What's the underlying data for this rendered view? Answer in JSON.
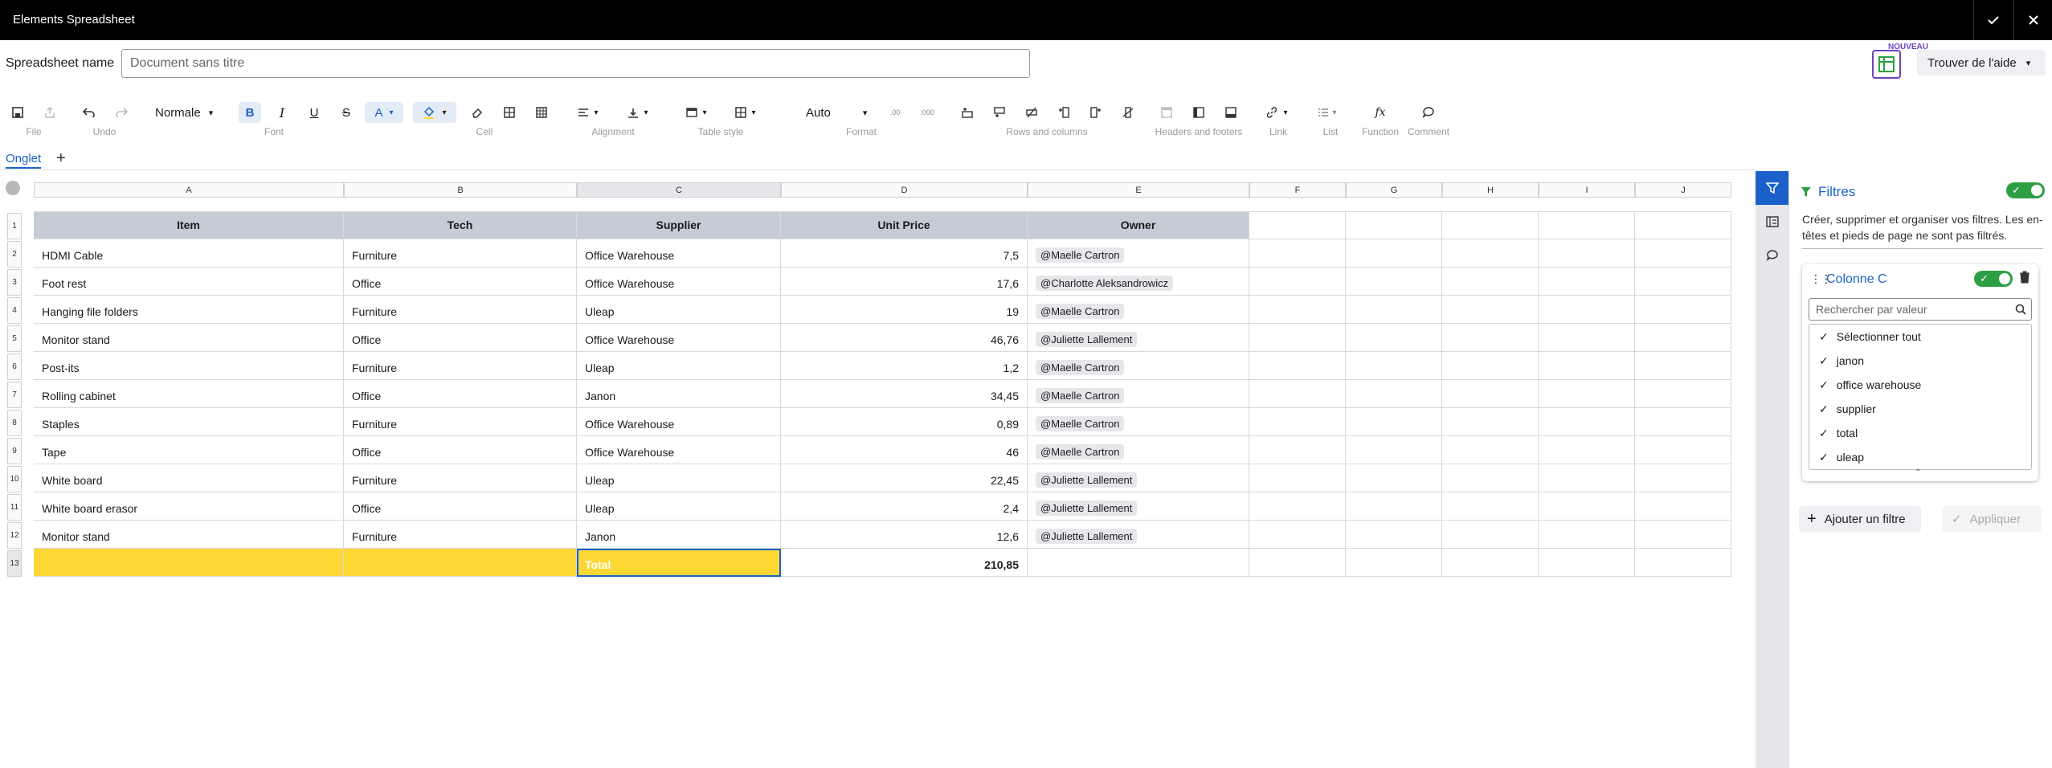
{
  "window": {
    "title": "Elements Spreadsheet"
  },
  "namebar": {
    "label": "Spreadsheet name",
    "value": "Document sans titre",
    "badge": "NOUVEAU",
    "help": "Trouver de l'aide"
  },
  "toolbar": {
    "groups": [
      "File",
      "Undo",
      "Font",
      "Cell",
      "Alignment",
      "Table style",
      "Format",
      "Rows and columns",
      "Headers and footers",
      "Link",
      "List",
      "Function",
      "Comment"
    ],
    "style_select": "Normale",
    "format_select": "Auto"
  },
  "tabs": {
    "active": "Onglet",
    "add": "+"
  },
  "grid": {
    "columns": [
      "A",
      "B",
      "C",
      "D",
      "E",
      "F",
      "G",
      "H",
      "I",
      "J"
    ],
    "rows": [
      "1",
      "2",
      "3",
      "4",
      "5",
      "6",
      "7",
      "8",
      "9",
      "10",
      "11",
      "12",
      "13"
    ],
    "header": [
      "Item",
      "Tech",
      "Supplier",
      "Unit Price",
      "Owner"
    ],
    "data": [
      [
        "HDMI Cable",
        "Furniture",
        "Office Warehouse",
        "7,5",
        "@Maelle Cartron"
      ],
      [
        "Foot rest",
        "Office",
        "Office Warehouse",
        "17,6",
        "@Charlotte Aleksandrowicz"
      ],
      [
        "Hanging file folders",
        "Furniture",
        "Uleap",
        "19",
        "@Maelle Cartron"
      ],
      [
        "Monitor stand",
        "Office",
        "Office Warehouse",
        "46,76",
        "@Juliette Lallement"
      ],
      [
        "Post-its",
        "Furniture",
        "Uleap",
        "1,2",
        "@Maelle Cartron"
      ],
      [
        "Rolling cabinet",
        "Office",
        "Janon",
        "34,45",
        "@Maelle Cartron"
      ],
      [
        "Staples",
        "Furniture",
        "Office Warehouse",
        "0,89",
        "@Maelle Cartron"
      ],
      [
        "Tape",
        "Office",
        "Office Warehouse",
        "46",
        "@Maelle Cartron"
      ],
      [
        "White board",
        "Furniture",
        "Uleap",
        "22,45",
        "@Juliette Lallement"
      ],
      [
        "White board erasor",
        "Office",
        "Uleap",
        "2,4",
        "@Juliette Lallement"
      ],
      [
        "Monitor stand",
        "Furniture",
        "Janon",
        "12,6",
        "@Juliette Lallement"
      ]
    ],
    "total": {
      "label": "Total",
      "value": "210,85"
    }
  },
  "panel": {
    "title": "Filtres",
    "description": "Créer, supprimer et organiser vos filtres. Les en-têtes et pieds de page ne sont pas filtrés.",
    "filter": {
      "column": "Colonne C",
      "search_placeholder": "Rechercher par valeur",
      "options": [
        "Sélectionner tout",
        "janon",
        "office warehouse",
        "supplier",
        "total",
        "uleap"
      ]
    },
    "add_filter": "Ajouter un filtre",
    "apply": "Appliquer"
  },
  "colors": {
    "accent": "#1b61c9",
    "header_fill": "#c5ccd6",
    "total_fill": "#fdd835",
    "toggle_on": "#2e9e44"
  }
}
